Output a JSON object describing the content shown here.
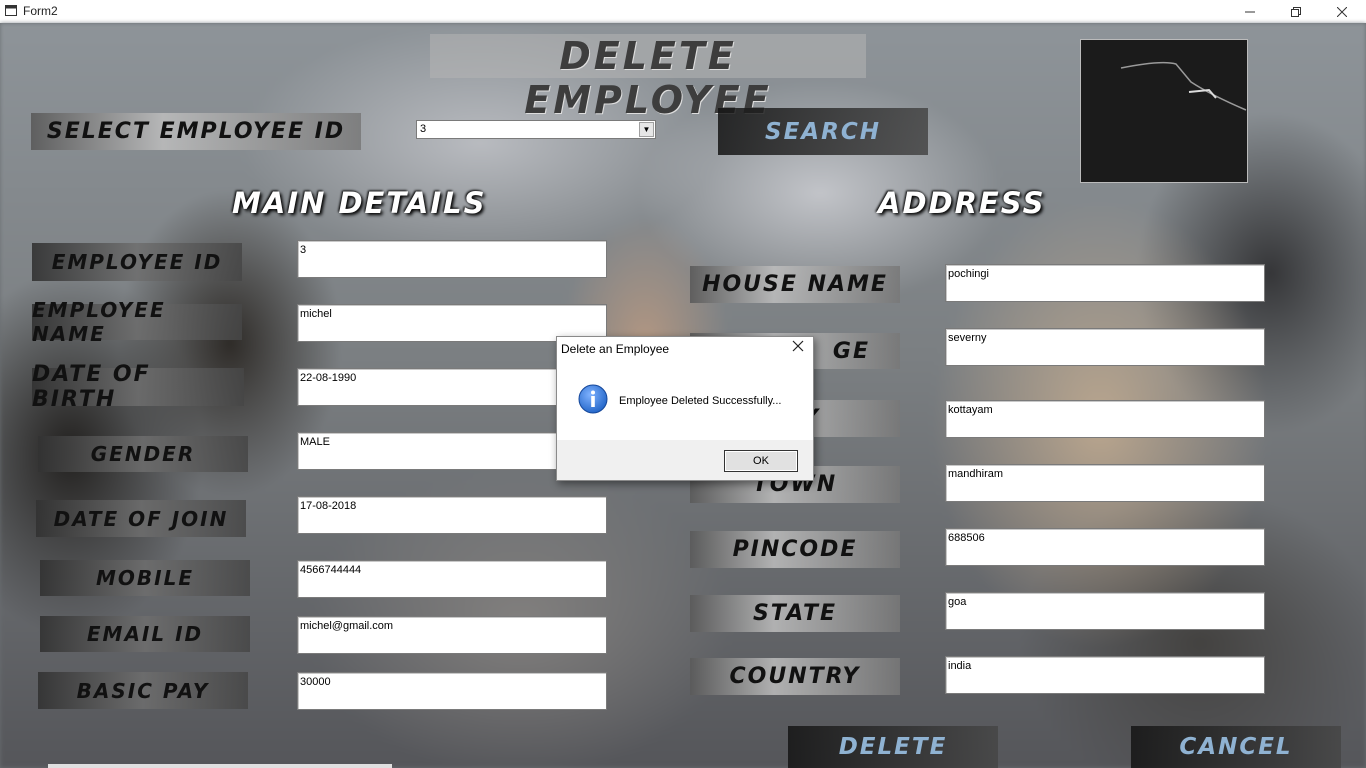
{
  "window": {
    "title": "Form2",
    "icons": {
      "app": "form-app-icon",
      "minimize": "minimize-icon",
      "restore": "restore-icon",
      "close": "close-icon"
    }
  },
  "header": {
    "title": "DELETE EMPLOYEE",
    "select_label": "SELECT EMPLOYEE ID",
    "selected_id": "3",
    "search_label": "SEARCH"
  },
  "main_details": {
    "title": "MAIN DETAILS",
    "fields": [
      {
        "label": "EMPLOYEE ID",
        "value": "3"
      },
      {
        "label": "EMPLOYEE NAME",
        "value": "michel"
      },
      {
        "label": "DATE OF BIRTH",
        "value": "22-08-1990"
      },
      {
        "label": "GENDER",
        "value": "MALE"
      },
      {
        "label": "DATE OF JOIN",
        "value": "17-08-2018"
      },
      {
        "label": "MOBILE",
        "value": "4566744444"
      },
      {
        "label": "EMAIL ID",
        "value": "michel@gmail.com"
      },
      {
        "label": "BASIC PAY",
        "value": "30000"
      }
    ]
  },
  "address": {
    "title": "ADDRESS",
    "fields": [
      {
        "label": "HOUSE NAME",
        "value": "pochingi"
      },
      {
        "label": "GE",
        "value": "severny"
      },
      {
        "label": "Y",
        "value": "kottayam"
      },
      {
        "label": "TOWN",
        "value": "mandhiram"
      },
      {
        "label": "PINCODE",
        "value": "688506"
      },
      {
        "label": "STATE",
        "value": "goa"
      },
      {
        "label": "COUNTRY",
        "value": "india"
      }
    ]
  },
  "actions": {
    "delete_label": "DELETE",
    "cancel_label": "CANCEL"
  },
  "dialog": {
    "title": "Delete an Employee",
    "message": "Employee Deleted Successfully...",
    "ok_label": "OK",
    "icon": "info-icon"
  },
  "colors": {
    "button_text": "#8fb2d2",
    "dialog_icon": "#1f63c6"
  }
}
